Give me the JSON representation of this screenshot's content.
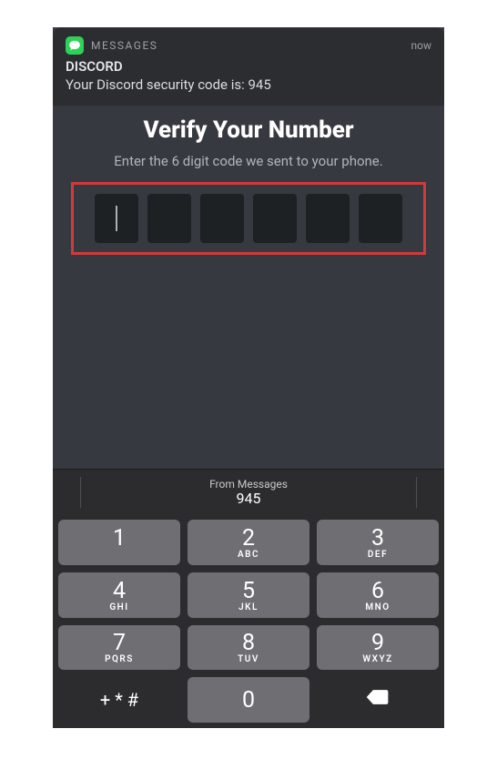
{
  "notification": {
    "app_label": "MESSAGES",
    "time": "now",
    "sender": "DISCORD",
    "body": "Your Discord security code is: 945"
  },
  "screen": {
    "title": "Verify Your Number",
    "subtitle": "Enter the 6 digit code we sent to your phone."
  },
  "code_inputs": {
    "digits": [
      "",
      "",
      "",
      "",
      "",
      ""
    ],
    "active_index": 0
  },
  "suggestion": {
    "label": "From Messages",
    "value": "945"
  },
  "keypad": {
    "keys": [
      {
        "digit": "1",
        "letters": ""
      },
      {
        "digit": "2",
        "letters": "ABC"
      },
      {
        "digit": "3",
        "letters": "DEF"
      },
      {
        "digit": "4",
        "letters": "GHI"
      },
      {
        "digit": "5",
        "letters": "JKL"
      },
      {
        "digit": "6",
        "letters": "MNO"
      },
      {
        "digit": "7",
        "letters": "PQRS"
      },
      {
        "digit": "8",
        "letters": "TUV"
      },
      {
        "digit": "9",
        "letters": "WXYZ"
      }
    ],
    "symbols": "+ * #",
    "zero": "0"
  },
  "colors": {
    "highlight_box": "#d03a3a",
    "app_bg": "#36393f",
    "key_bg": "#6f6f73"
  }
}
